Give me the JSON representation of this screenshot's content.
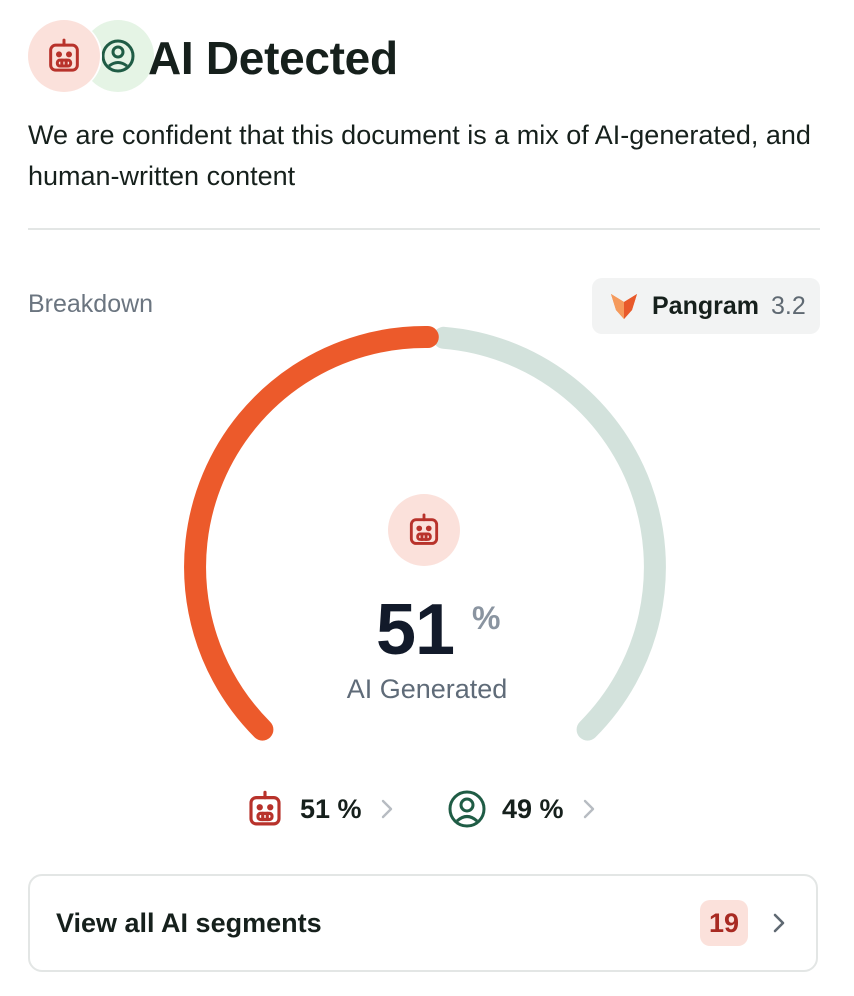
{
  "header": {
    "title": "AI Detected",
    "description": "We are confident that this document is a mix of AI-generated, and human-written content"
  },
  "breakdown": {
    "label": "Breakdown",
    "model": {
      "name": "Pangram",
      "version": "3.2"
    }
  },
  "gauge": {
    "ai_percent": 51,
    "value": "51",
    "percent_symbol": "%",
    "label": "AI Generated"
  },
  "split": {
    "ai": {
      "value": "51 %",
      "percent": 51
    },
    "human": {
      "value": "49 %",
      "percent": 49
    }
  },
  "segments": {
    "label": "View all AI segments",
    "count": "19"
  },
  "colors": {
    "ai_accent": "#ec5a2b",
    "human_track": "#d3e2dc",
    "ai_icon": "#b8322b",
    "human_icon": "#1f5c45",
    "badge_bg": "#fbe1db"
  },
  "icons": {
    "ai": "robot-icon",
    "human": "user-circle-icon",
    "model": "fox-icon",
    "chevron": "chevron-right-icon"
  }
}
